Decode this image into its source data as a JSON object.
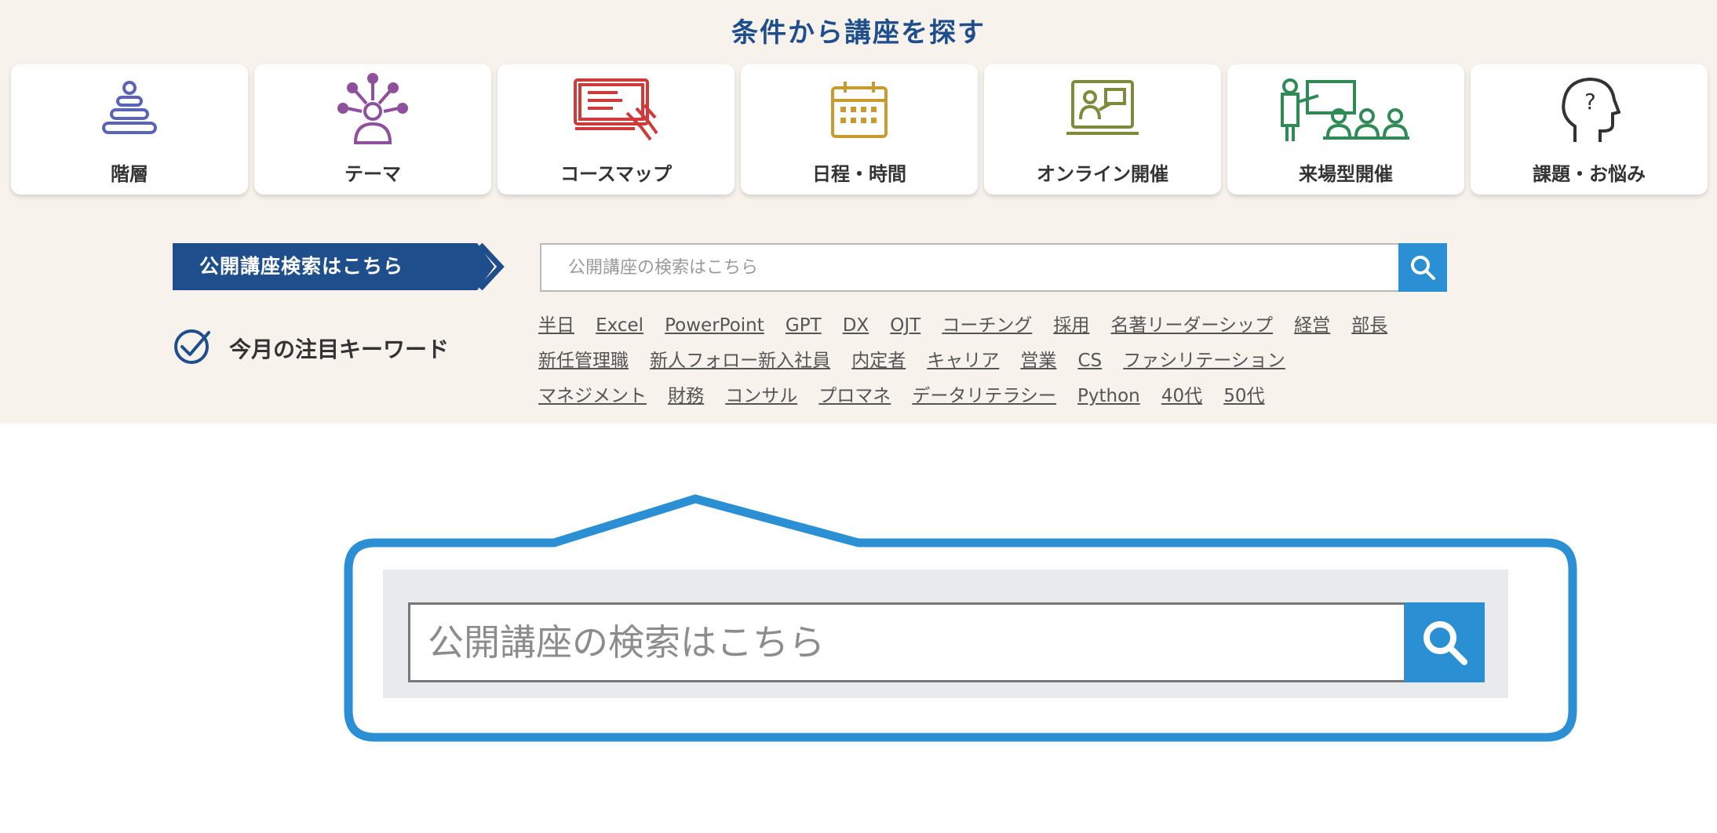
{
  "section": {
    "title": "条件から講座を探す"
  },
  "categories": [
    {
      "label": "階層",
      "icon": "stacked-rings-icon",
      "color": "#5b63b7"
    },
    {
      "label": "テーマ",
      "icon": "network-person-icon",
      "color": "#8e4f9c"
    },
    {
      "label": "コースマップ",
      "icon": "map-hand-icon",
      "color": "#cf3b3b"
    },
    {
      "label": "日程・時間",
      "icon": "calendar-icon",
      "color": "#c99a2e"
    },
    {
      "label": "オンライン開催",
      "icon": "online-laptop-icon",
      "color": "#7f8a3c"
    },
    {
      "label": "来場型開催",
      "icon": "classroom-icon",
      "color": "#2f8a56"
    },
    {
      "label": "課題・お悩み",
      "icon": "head-question-icon",
      "color": "#333333"
    }
  ],
  "search": {
    "label": "公開講座検索はこちら",
    "placeholder": "公開講座の検索はこちら",
    "value": ""
  },
  "keywords": {
    "label": "今月の注目キーワード",
    "lines": [
      [
        "半日",
        "Excel",
        "PowerPoint",
        "GPT",
        "DX",
        "OJT",
        "コーチング",
        "採用",
        "名著リーダーシップ",
        "経営",
        "部長"
      ],
      [
        "新任管理職",
        "新人フォロー新入社員",
        "内定者",
        "キャリア",
        "営業",
        "CS",
        "ファシリテーション"
      ],
      [
        "マネジメント",
        "財務",
        "コンサル",
        "プロマネ",
        "データリテラシー",
        "Python",
        "40代",
        "50代"
      ]
    ]
  },
  "zoom": {
    "placeholder": "公開講座の検索はこちら"
  },
  "colors": {
    "navy": "#1e4e8c",
    "blue": "#2b8fd4",
    "panel": "#f7f2ec"
  }
}
